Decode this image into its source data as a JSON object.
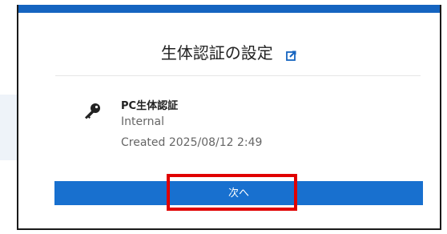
{
  "dialog": {
    "title": "生体認証の設定",
    "external_link_icon": "external-link-icon"
  },
  "credential": {
    "icon": "key-icon",
    "name": "PC生体認証",
    "type": "Internal",
    "created": "Created 2025/08/12 2:49"
  },
  "actions": {
    "next_label": "次へ"
  },
  "colors": {
    "accent": "#1564c0",
    "button": "#1870cf",
    "highlight": "#e00000"
  }
}
